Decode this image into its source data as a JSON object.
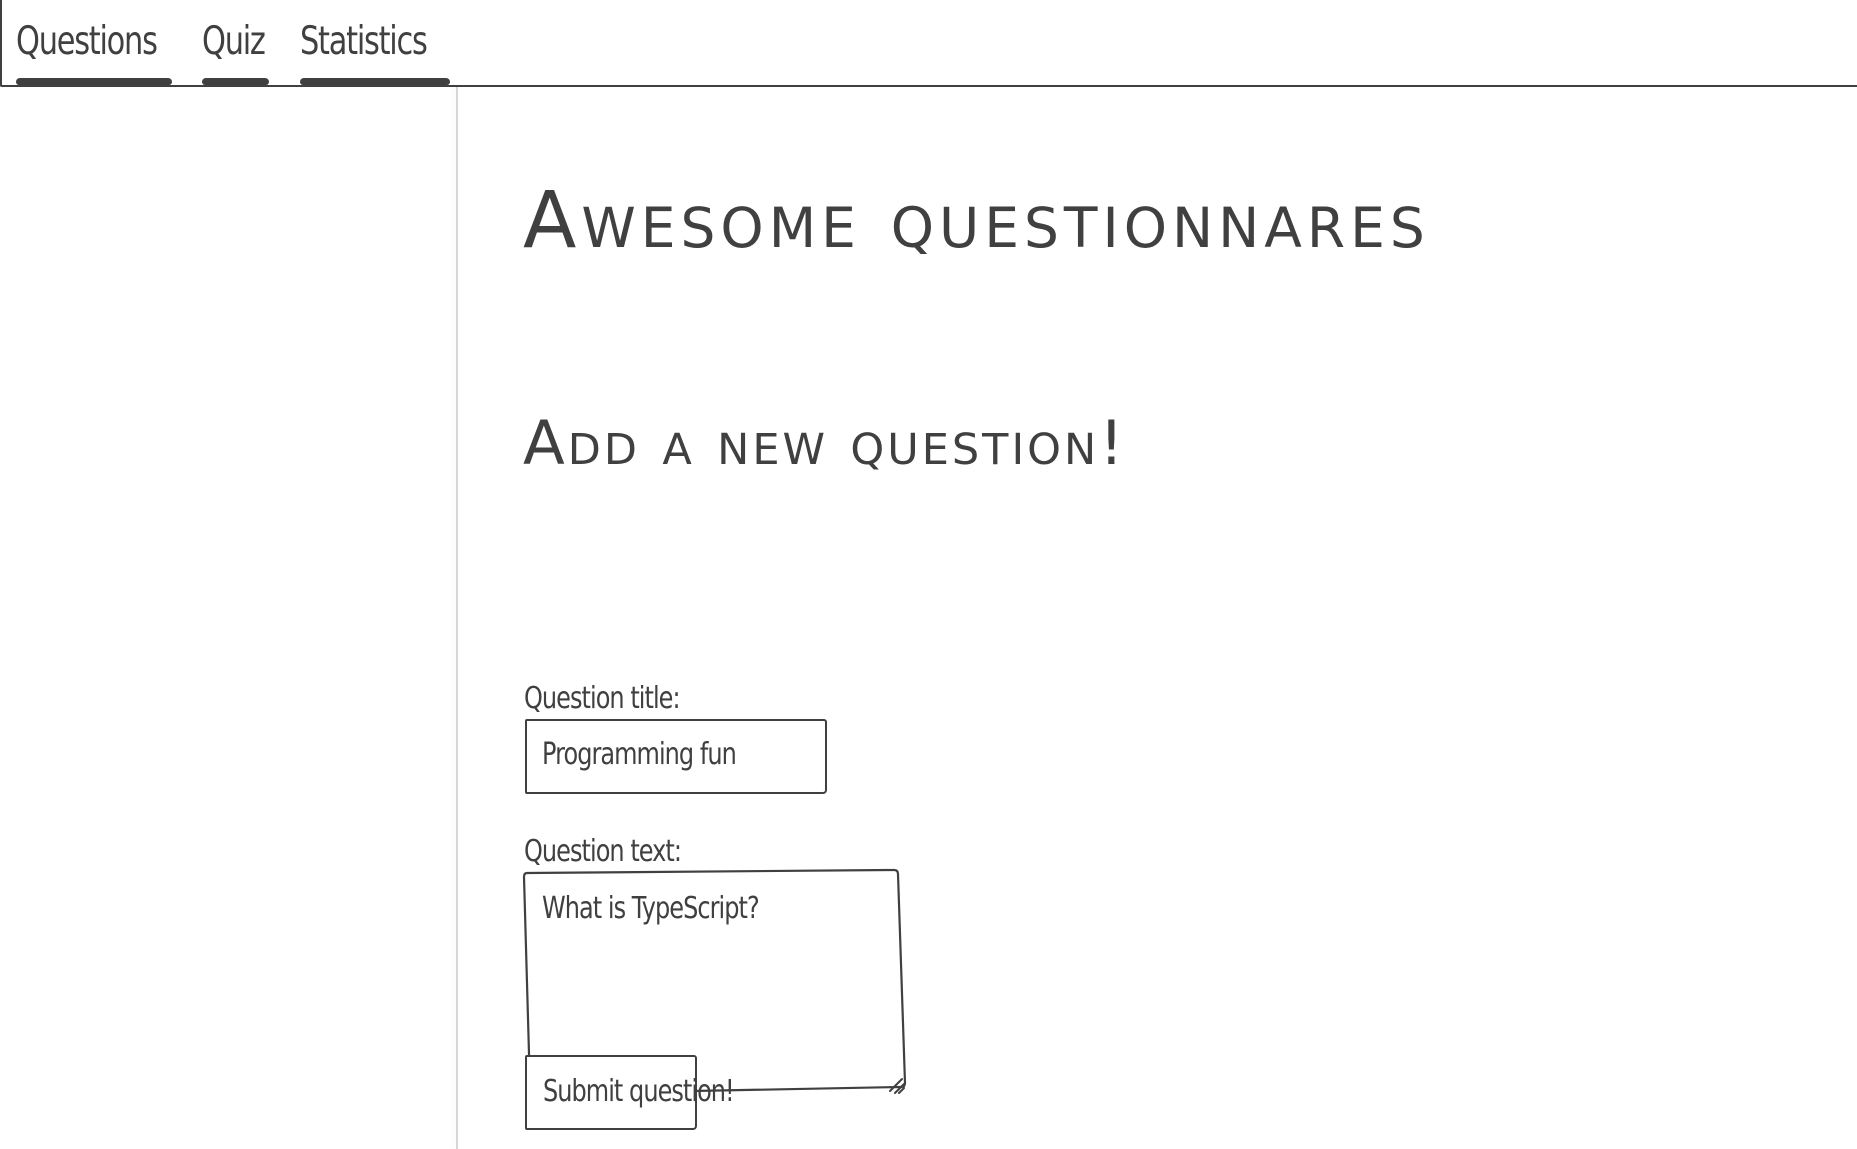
{
  "nav": {
    "tabs": [
      {
        "label": "Questions"
      },
      {
        "label": "Quiz"
      },
      {
        "label": "Statistics"
      }
    ]
  },
  "main": {
    "title": "Awesome questionnares",
    "subtitle": "Add a new question!",
    "form": {
      "title_label": "Question title:",
      "title_value": "Programming fun",
      "text_label": "Question text:",
      "text_value": "What is TypeScript?",
      "submit_label": "Submit question!"
    }
  }
}
